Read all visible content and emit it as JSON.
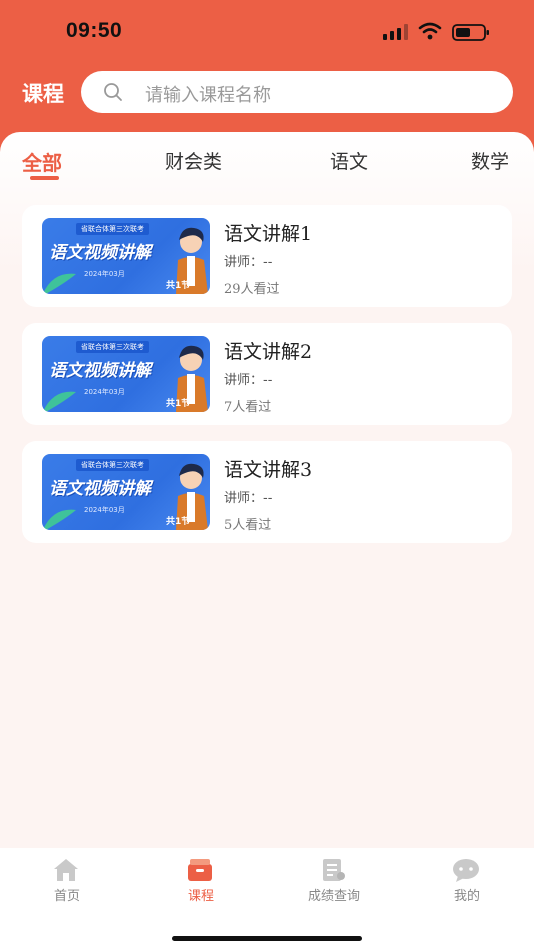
{
  "status": {
    "time": "09:50"
  },
  "header": {
    "title": "课程",
    "search_placeholder": "请输入课程名称"
  },
  "tabs": [
    {
      "label": "全部",
      "active": true
    },
    {
      "label": "财会类",
      "active": false
    },
    {
      "label": "语文",
      "active": false
    },
    {
      "label": "数学",
      "active": false
    }
  ],
  "courses": [
    {
      "title": "语文讲解1",
      "teacher": "讲师：--",
      "views": "29人看过",
      "thumb": {
        "top": "省联合体第三次联考",
        "main": "语文视频讲解",
        "date": "2024年03月",
        "count": "共1节"
      }
    },
    {
      "title": "语文讲解2",
      "teacher": "讲师：--",
      "views": "7人看过",
      "thumb": {
        "top": "省联合体第三次联考",
        "main": "语文视频讲解",
        "date": "2024年03月",
        "count": "共1节"
      }
    },
    {
      "title": "语文讲解3",
      "teacher": "讲师：--",
      "views": "5人看过",
      "thumb": {
        "top": "省联合体第三次联考",
        "main": "语文视频讲解",
        "date": "2024年03月",
        "count": "共1节"
      }
    }
  ],
  "tabbar": [
    {
      "label": "首页",
      "icon": "home-icon",
      "active": false
    },
    {
      "label": "课程",
      "icon": "course-box-icon",
      "active": true
    },
    {
      "label": "成绩查询",
      "icon": "score-report-icon",
      "active": false
    },
    {
      "label": "我的",
      "icon": "chat-bubble-icon",
      "active": false
    }
  ],
  "colors": {
    "accent": "#ec5f45",
    "thumb_blue": "#3a7ce8"
  }
}
